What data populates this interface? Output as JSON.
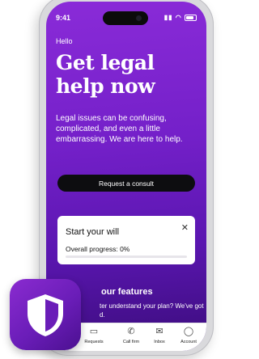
{
  "status_bar": {
    "time": "9:41"
  },
  "hero": {
    "greeting": "Hello",
    "headline": "Get legal help now",
    "body": "Legal issues can be confusing, complicated, and even a little embarrassing. We are here to help.",
    "cta_label": "Request a consult"
  },
  "will_card": {
    "title": "Start your will",
    "progress_label": "Overall progress: 0%",
    "progress_value": 0
  },
  "features": {
    "title": "our features",
    "text": "ter understand your plan? We've got d."
  },
  "tabs": [
    {
      "label": "Requests",
      "icon": "folder-icon"
    },
    {
      "label": "Call firm",
      "icon": "phone-icon"
    },
    {
      "label": "Inbox",
      "icon": "inbox-icon"
    },
    {
      "label": "Account",
      "icon": "account-icon"
    }
  ],
  "colors": {
    "brand_purple": "#7420c9",
    "button_dark": "#0d0d10",
    "card_white": "#ffffff"
  }
}
